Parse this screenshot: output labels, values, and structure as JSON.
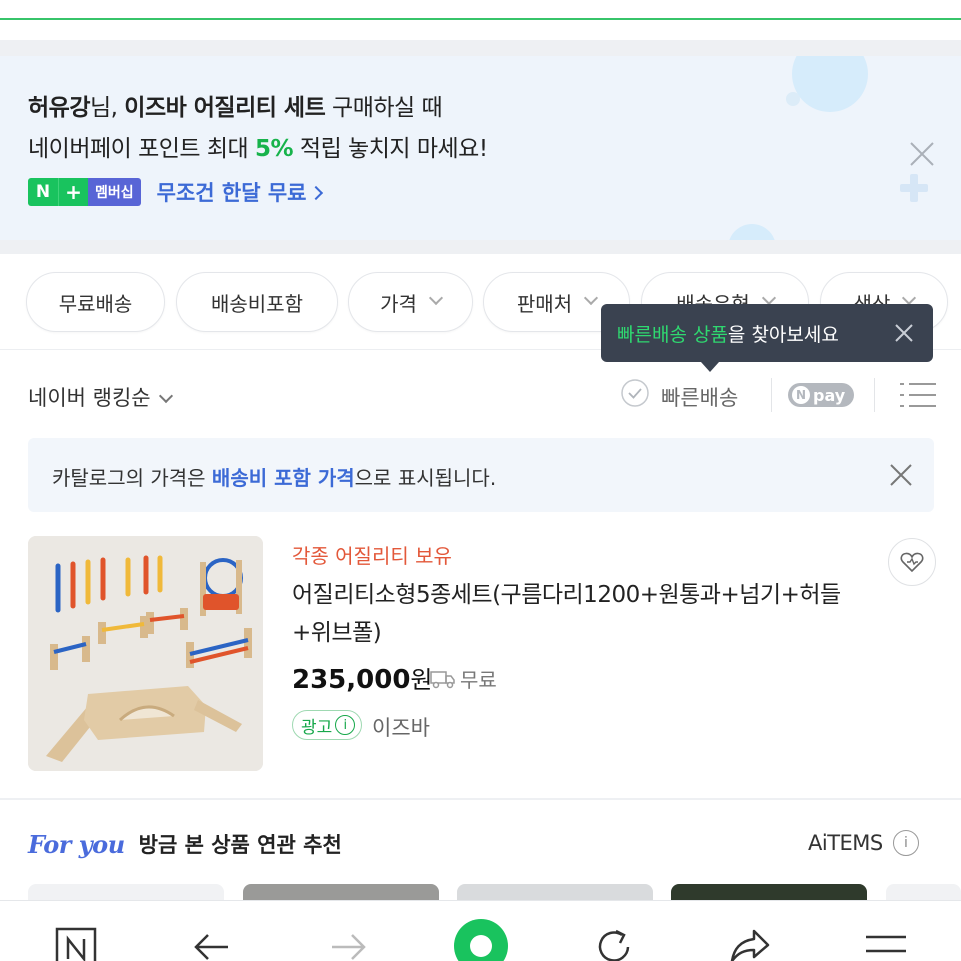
{
  "promo": {
    "user_name": "허유강",
    "honorific": "님, ",
    "product_name": "이즈바 어질리티 세트",
    "line1_suffix": " 구매하실 때",
    "line2_prefix": "네이버페이 포인트 최대 ",
    "percent": "5%",
    "line2_suffix": " 적립 놓치지 마세요!",
    "badge_n": "N",
    "badge_plus": "+",
    "badge_membership": "멤버십",
    "free_month_link": "무조건 한달 무료"
  },
  "filters": {
    "chips": [
      {
        "label": "무료배송"
      },
      {
        "label": "배송비포함"
      },
      {
        "label": "가격"
      },
      {
        "label": "판매처"
      },
      {
        "label": "배송유형"
      },
      {
        "label": "색상"
      }
    ]
  },
  "tooltip": {
    "highlight": "빠른배송 상품",
    "text": "을 찾아보세요"
  },
  "sortbar": {
    "sort_label": "네이버 랭킹순",
    "fast_delivery": "빠른배송",
    "npay_label": "pay",
    "npay_n": "N"
  },
  "notice": {
    "prefix": "카탈로그의 가격은 ",
    "highlight": "배송비 포함 가격",
    "suffix": "으로 표시됩니다."
  },
  "product": {
    "tag": "각종 어질리티 보유",
    "title": "어질리티소형5종세트(구름다리1200+원통과+넘기+허들+위브폴)",
    "price": "235,000",
    "currency": "원",
    "shipping": "무료",
    "ad_label": "광고",
    "ad_info": "i",
    "seller": "이즈바"
  },
  "recommend": {
    "for_you": "For you",
    "title": "방금 본 상품 연관 추천",
    "aitems": "AiTEMS",
    "info": "i"
  },
  "colors": {
    "brand_green": "#19c35e",
    "link_blue": "#3c6ad6",
    "tag_orange": "#e3583a",
    "tooltip_bg": "#3a4250"
  }
}
